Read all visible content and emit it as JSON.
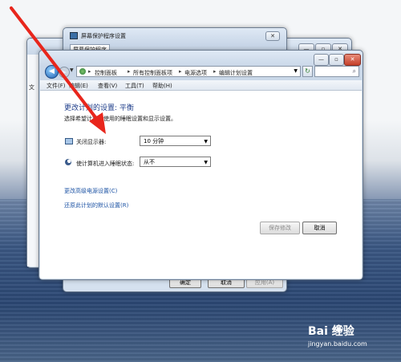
{
  "screensaver_window": {
    "title": "屏幕保护程序设置",
    "tab": "屏幕保护程序",
    "side_text": "文",
    "buttons": {
      "ok": "确定",
      "cancel": "取消",
      "apply": "应用(A)"
    }
  },
  "main_window": {
    "breadcrumb": [
      "控制面板",
      "所有控制面板项",
      "电源选项",
      "编辑计划设置"
    ],
    "menu": [
      "文件(F)",
      "编辑(E)",
      "查看(V)",
      "工具(T)",
      "帮助(H)"
    ],
    "heading": "更改计划的设置: 平衡",
    "subheading": "选择希望计算机使用的睡眠设置和显示设置。",
    "settings": [
      {
        "label": "关闭显示器:",
        "value": "10 分钟"
      },
      {
        "label": "使计算机进入睡眠状态:",
        "value": "从不"
      }
    ],
    "links": {
      "advanced": "更改高级电源设置(C)",
      "restore": "还原此计划的默认设置(R)"
    },
    "buttons": {
      "save": "保存修改",
      "cancel": "取消"
    }
  },
  "watermark": {
    "brand": "Bai 经验",
    "url": "jingyan.baidu.com"
  },
  "colors": {
    "arrow": "#e8261c",
    "link": "#1e54a5",
    "heading": "#1e3d8a"
  }
}
